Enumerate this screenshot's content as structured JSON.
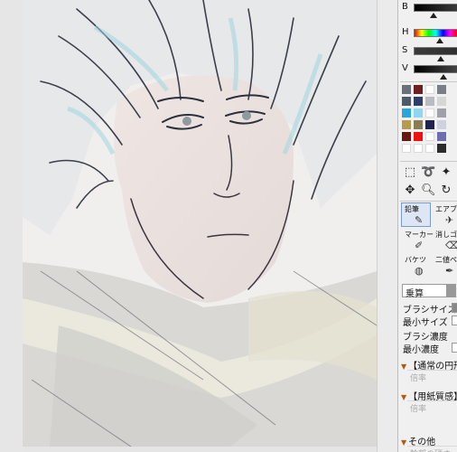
{
  "color_sliders": [
    {
      "label": "B",
      "level": 0.45,
      "gradient": "linear-gradient(to right,#000,#3a3a3a)"
    },
    {
      "label": "H",
      "level": 0.6,
      "gradient": "linear-gradient(to right,#f00,#ff0,#0f0,#0ff,#00f,#f0f,#f00)"
    },
    {
      "label": "S",
      "level": 0.62,
      "gradient": "linear-gradient(to right,#3a3a3a,#303030)"
    },
    {
      "label": "V",
      "level": 0.68,
      "gradient": "linear-gradient(to right,#000,#444)"
    }
  ],
  "swatch_colors": [
    [
      "#6a6f79",
      "#6e1e1e",
      "#ffffff",
      "#7a7f87"
    ],
    [
      "#4d5a6a",
      "#2f3e66",
      "#b9bcc0",
      "#d6d6d6"
    ],
    [
      "#2aa7d8",
      "#8ed6f2",
      "#ffffff",
      "#a0a0a8"
    ],
    [
      "#b89a4e",
      "#8a7d56",
      "#1f2350",
      "#cfd0e0"
    ],
    [
      "#6a1515",
      "#ee1111",
      "#ffffff",
      "#6d6db0"
    ],
    [
      "#ffffff",
      "#ffffff",
      "#ffffff",
      "#2b2b2b"
    ]
  ],
  "tools": {
    "row1": [
      "rect-select-icon",
      "lasso-select-icon",
      "magic-wand-icon"
    ],
    "row2": [
      "move-icon",
      "zoom-icon",
      "rotate-icon"
    ]
  },
  "brushes": [
    {
      "name": "鉛筆",
      "icon": "pencil-icon",
      "selected": true
    },
    {
      "name": "エアブラ",
      "icon": "airbrush-icon",
      "selected": false
    },
    {
      "name": "マーカー",
      "icon": "marker-icon",
      "selected": false
    },
    {
      "name": "消しゴム",
      "icon": "eraser-icon",
      "selected": false
    },
    {
      "name": "バケツ",
      "icon": "bucket-icon",
      "selected": false
    },
    {
      "name": "二値ペン",
      "icon": "binary-pen-icon",
      "selected": false
    }
  ],
  "blend_mode": "乗算",
  "properties": [
    {
      "label": "ブラシサイズ"
    },
    {
      "label": "最小サイズ"
    },
    {
      "label": "ブラシ濃度"
    },
    {
      "label": "最小濃度"
    }
  ],
  "sections": [
    {
      "title": "【通常の円形",
      "sub": "倍率"
    },
    {
      "title": "【用紙質感】",
      "sub": "倍率"
    },
    {
      "title": "その他",
      "sub": "輪郭の硬さ"
    }
  ]
}
